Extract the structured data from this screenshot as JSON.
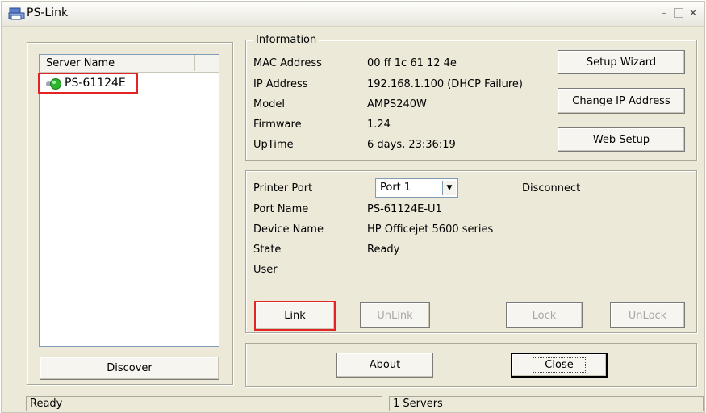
{
  "window": {
    "title": "PS-Link",
    "controls": {
      "minimize": "–",
      "maximize": "□",
      "close": "✕"
    }
  },
  "server_list": {
    "column_header": "Server Name",
    "items": [
      {
        "name": "PS-61124E",
        "status": "online"
      }
    ]
  },
  "discover_button": "Discover",
  "information": {
    "legend": "Information",
    "labels": {
      "mac": "MAC Address",
      "ip": "IP Address",
      "model": "Model",
      "firmware": "Firmware",
      "uptime": "UpTime"
    },
    "values": {
      "mac": "00 ff 1c 61 12 4e",
      "ip": "192.168.1.100 (DHCP Failure)",
      "model": "AMPS240W",
      "firmware": "1.24",
      "uptime": "6 days, 23:36:19"
    },
    "buttons": {
      "setup_wizard": "Setup Wizard",
      "change_ip": "Change IP Address",
      "web_setup": "Web Setup"
    }
  },
  "printer": {
    "labels": {
      "port": "Printer Port",
      "port_name": "Port Name",
      "device_name": "Device Name",
      "state": "State",
      "user": "User"
    },
    "port_selected": "Port 1",
    "connection_status": "Disconnect",
    "values": {
      "port_name": "PS-61124E-U1",
      "device_name": "HP Officejet 5600 series",
      "state": "Ready",
      "user": ""
    },
    "buttons": {
      "link": "Link",
      "unlink": "UnLink",
      "lock": "Lock",
      "unlock": "UnLock"
    }
  },
  "footer_buttons": {
    "about": "About",
    "close": "Close"
  },
  "status_bar": {
    "left": "Ready",
    "right": "1 Servers"
  }
}
